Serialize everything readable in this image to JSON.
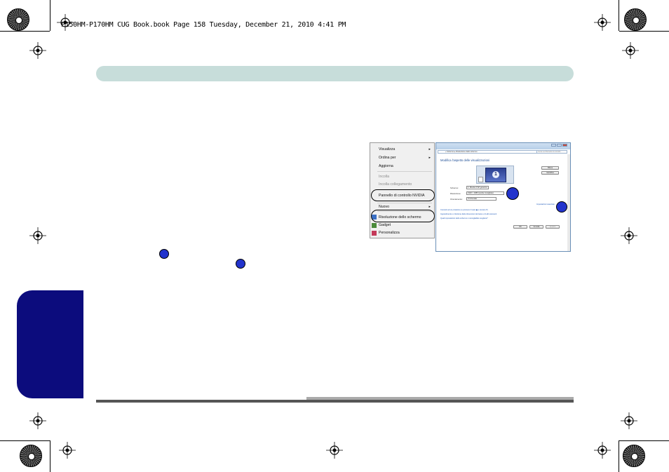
{
  "header": {
    "running_text": "P150HM-P170HM CUG Book.book  Page 158  Tuesday, December 21, 2010  4:41 PM"
  },
  "callouts": {
    "body_1": "1",
    "body_2": "2",
    "image_1": "1",
    "image_2": "2"
  },
  "context_menu": {
    "items": [
      {
        "label": "Visualizza",
        "arrow": "▸"
      },
      {
        "label": "Ordina per",
        "arrow": "▸"
      },
      {
        "label": "Aggiorna",
        "arrow": ""
      },
      {
        "label": "Incolla",
        "arrow": ""
      },
      {
        "label": "Incolla collegamento",
        "arrow": ""
      },
      {
        "label": "Pannello di controllo NVIDIA",
        "arrow": ""
      },
      {
        "label": "Nuovo",
        "arrow": "▸"
      },
      {
        "label": "Risoluzione dello schermo",
        "arrow": ""
      },
      {
        "label": "Gadget",
        "arrow": ""
      },
      {
        "label": "Personalizza",
        "arrow": ""
      }
    ]
  },
  "control_panel": {
    "breadcrumb": "« Schermo ▸ Risoluzione dello schermo",
    "search_placeholder": "Cerca nel Pannello di controllo",
    "heading": "Modifica l'aspetto delle visualizzazioni",
    "monitor_number": "1",
    "detect_button": "Rileva",
    "identify_button": "Identifica",
    "fields": [
      {
        "label": "Schermo:",
        "value": "1. Monitor PnP generico"
      },
      {
        "label": "Risoluzione:",
        "value": "1920 × 1080 (scelta consigliata)"
      },
      {
        "label": "Orientamento:",
        "value": "Orizzontale"
      }
    ],
    "advanced_link": "Impostazioni avanzate",
    "links": [
      "Connetti ad un proiettore (o premere il tasto ◼ e toccare P)",
      "Ingrandimento o riduzione delle dimensioni del testo e di altri elementi",
      "Quali impostazioni dello schermo è consigliabile scegliere?"
    ],
    "ok_button": "OK",
    "cancel_button": "Annulla",
    "apply_button": "Applica"
  },
  "colors": {
    "top_bar": "#c7ddda",
    "side_tab": "#0c0c7d",
    "callout": "#2233cc"
  }
}
